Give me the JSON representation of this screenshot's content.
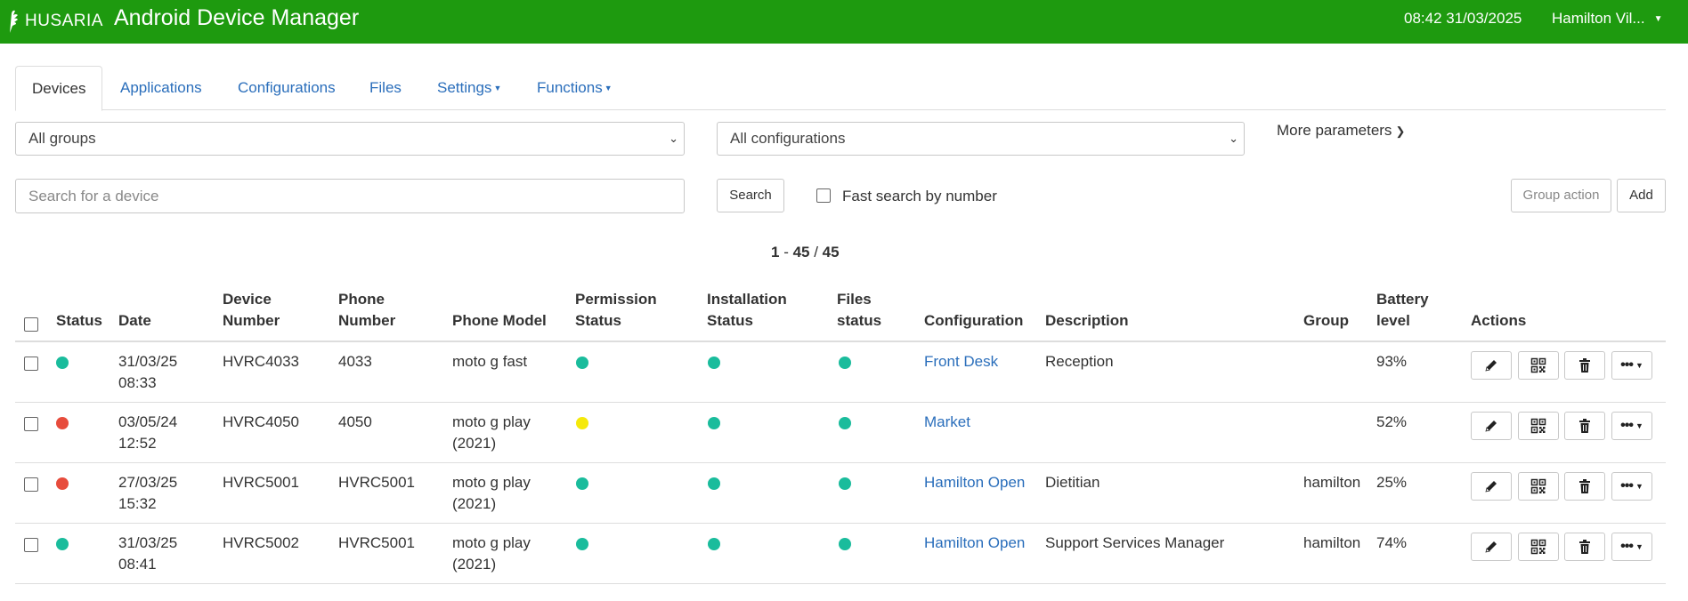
{
  "header": {
    "brand": "HUSARIA",
    "title": "Android Device Manager",
    "datetime": "08:42 31/03/2025",
    "user": "Hamilton Vil..."
  },
  "tabs": [
    {
      "label": "Devices"
    },
    {
      "label": "Applications"
    },
    {
      "label": "Configurations"
    },
    {
      "label": "Files"
    },
    {
      "label": "Settings"
    },
    {
      "label": "Functions"
    }
  ],
  "filters": {
    "group_select": "All groups",
    "config_select": "All configurations",
    "more_params": "More parameters"
  },
  "search": {
    "placeholder": "Search for a device",
    "button": "Search",
    "fast_search_label": "Fast search by number",
    "group_action": "Group action",
    "add": "Add"
  },
  "pager": {
    "from": "1",
    "to": "45",
    "total": "45"
  },
  "columns": {
    "status": "Status",
    "date": "Date",
    "device_number_1": "Device",
    "device_number_2": "Number",
    "phone_number_1": "Phone",
    "phone_number_2": "Number",
    "phone_model": "Phone Model",
    "permission_1": "Permission",
    "permission_2": "Status",
    "installation_1": "Installation",
    "installation_2": "Status",
    "files_1": "Files",
    "files_2": "status",
    "configuration": "Configuration",
    "description": "Description",
    "group": "Group",
    "battery_1": "Battery",
    "battery_2": "level",
    "actions": "Actions"
  },
  "colors": {
    "green": "#1abc9c",
    "red": "#e74c3c",
    "yellow": "#f5e90a"
  },
  "rows": [
    {
      "status": "green",
      "date1": "31/03/25",
      "date2": "08:33",
      "device": "HVRC4033",
      "phone": "4033",
      "model1": "moto g fast",
      "model2": "",
      "perm": "green",
      "inst": "green",
      "files": "green",
      "config": "Front Desk",
      "desc": "Reception",
      "group": "",
      "battery": "93%"
    },
    {
      "status": "red",
      "date1": "03/05/24",
      "date2": "12:52",
      "device": "HVRC4050",
      "phone": "4050",
      "model1": "moto g play",
      "model2": "(2021)",
      "perm": "yellow",
      "inst": "green",
      "files": "green",
      "config": "Market",
      "desc": "",
      "group": "",
      "battery": "52%"
    },
    {
      "status": "red",
      "date1": "27/03/25",
      "date2": "15:32",
      "device": "HVRC5001",
      "phone": "HVRC5001",
      "model1": "moto g play",
      "model2": "(2021)",
      "perm": "green",
      "inst": "green",
      "files": "green",
      "config": "Hamilton Open",
      "desc": "Dietitian",
      "group": "hamilton",
      "battery": "25%"
    },
    {
      "status": "green",
      "date1": "31/03/25",
      "date2": "08:41",
      "device": "HVRC5002",
      "phone": "HVRC5001",
      "model1": "moto g play",
      "model2": "(2021)",
      "perm": "green",
      "inst": "green",
      "files": "green",
      "config": "Hamilton Open",
      "desc": "Support Services Manager",
      "group": "hamilton",
      "battery": "74%"
    }
  ]
}
